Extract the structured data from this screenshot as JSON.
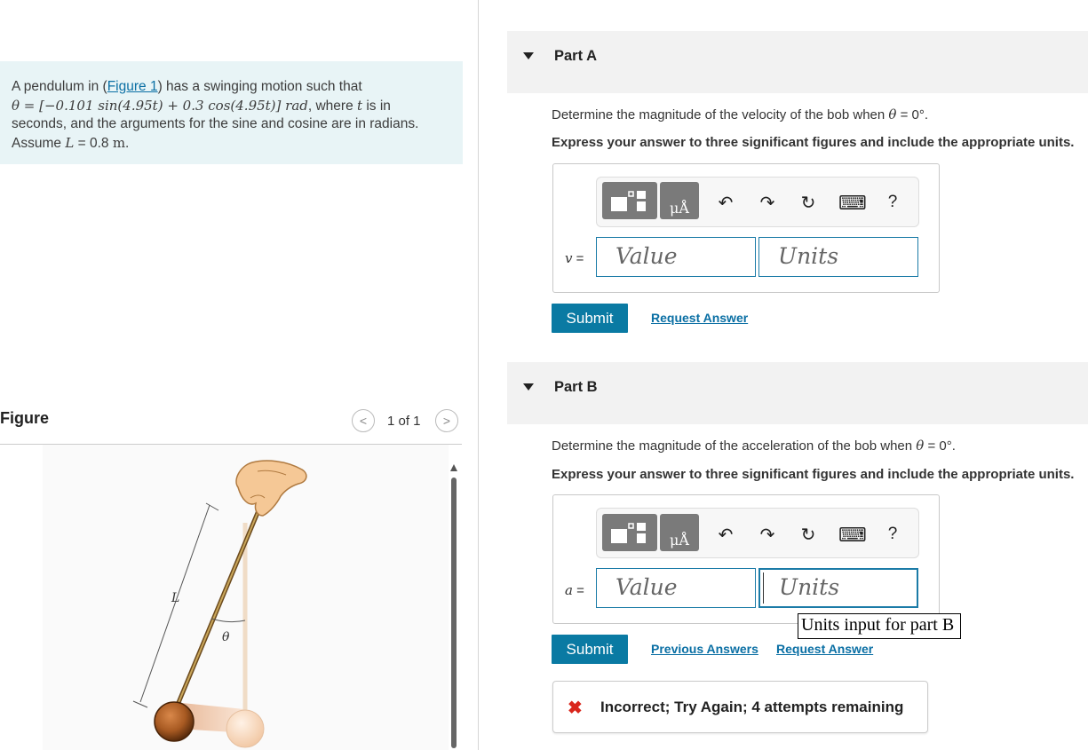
{
  "problem": {
    "prefix": "A pendulum in (",
    "figure_link": "Figure 1",
    "after_link": ") has a swinging motion such that",
    "equation_math": "θ = [−0.101 sin(4.95t) + 0.3 cos(4.95t)] rad",
    "after_equation_1": ", where ",
    "t_var": "t",
    "after_equation_2": " is in",
    "line3": "seconds, and the arguments for the sine and cosine are in radians.",
    "assume_prefix": "Assume ",
    "L_var": "L",
    "assume_value": " = 0.8 ",
    "unit": "m",
    "period": "."
  },
  "figure": {
    "title": "Figure",
    "page_count": "1 of 1",
    "prev_label": "<",
    "next_label": ">",
    "label_L": "L",
    "label_theta": "θ"
  },
  "parts": [
    {
      "title": "Part A",
      "question_prefix": "Determine the magnitude of the velocity of the bob when ",
      "question_var": "θ",
      "question_suffix": " = 0°.",
      "instruction": "Express your answer to three significant figures and include the appropriate units.",
      "var_label": "v",
      "value_placeholder": "Value",
      "units_placeholder": "Units",
      "submit_label": "Submit",
      "links": [
        "Request Answer"
      ]
    },
    {
      "title": "Part B",
      "question_prefix": "Determine the magnitude of the acceleration of the bob when ",
      "question_var": "θ",
      "question_suffix": " = 0°.",
      "instruction": "Express your answer to three significant figures and include the appropriate units.",
      "var_label": "a",
      "value_placeholder": "Value",
      "units_placeholder": "Units",
      "submit_label": "Submit",
      "links": [
        "Previous Answers",
        "Request Answer"
      ]
    }
  ],
  "toolbar": {
    "unit_button": "μÅ",
    "undo_icon": "↶",
    "redo_icon": "↷",
    "reset_icon": "↻",
    "keyboard_icon": "⌨",
    "help_label": "?"
  },
  "equals": " =",
  "tooltip": "Units input for part B",
  "feedback": {
    "icon": "✖",
    "message": "Incorrect; Try Again; 4 attempts remaining"
  },
  "colors": {
    "accent": "#0a7aa3",
    "problem_bg": "#e8f4f6",
    "error": "#d9261c",
    "link": "#0a6fa4"
  }
}
